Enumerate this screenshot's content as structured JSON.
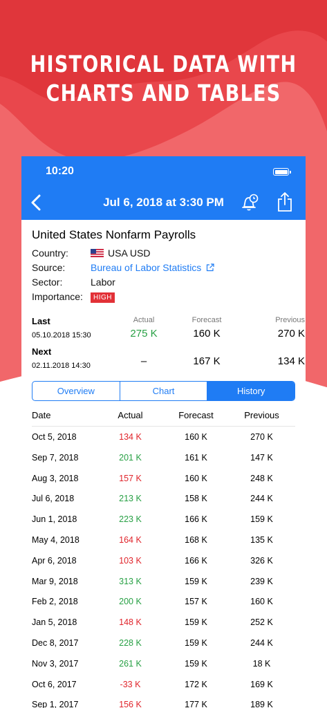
{
  "hero": {
    "line1": "HISTORICAL DATA WITH",
    "line2": "CHARTS AND TABLES"
  },
  "colors": {
    "brand_red": "#e23137",
    "nav_blue": "#1f7cf4",
    "positive": "#27a044",
    "negative": "#e0242b"
  },
  "status_bar": {
    "time": "10:20"
  },
  "nav": {
    "title": "Jul 6, 2018 at 3:30 PM",
    "back_icon": "chevron-left-icon",
    "alarm_icon": "alarm-clock-icon",
    "share_icon": "share-icon"
  },
  "event": {
    "title": "United States Nonfarm Payrolls",
    "country_label": "Country:",
    "country_value": "USA USD",
    "country_flag": "us-flag-icon",
    "source_label": "Source:",
    "source_value": "Bureau of Labor Statistics",
    "sector_label": "Sector:",
    "sector_value": "Labor",
    "importance_label": "Importance:",
    "importance_value": "HIGH"
  },
  "releases": {
    "headers": {
      "actual": "Actual",
      "forecast": "Forecast",
      "previous": "Previous"
    },
    "last": {
      "label": "Last",
      "date": "05.10.2018 15:30",
      "actual": "275 K",
      "forecast": "160 K",
      "previous": "270 K"
    },
    "next": {
      "label": "Next",
      "date": "02.11.2018 14:30",
      "actual": "–",
      "forecast": "167 K",
      "previous": "134 K"
    }
  },
  "tabs": {
    "overview": "Overview",
    "chart": "Chart",
    "history": "History",
    "active": "History"
  },
  "history": {
    "headers": {
      "date": "Date",
      "actual": "Actual",
      "forecast": "Forecast",
      "previous": "Previous"
    },
    "rows": [
      {
        "date": "Oct 5, 2018",
        "actual": "134 K",
        "trend": "down",
        "forecast": "160 K",
        "previous": "270 K"
      },
      {
        "date": "Sep 7, 2018",
        "actual": "201 K",
        "trend": "up",
        "forecast": "161 K",
        "previous": "147 K"
      },
      {
        "date": "Aug 3, 2018",
        "actual": "157 K",
        "trend": "down",
        "forecast": "160 K",
        "previous": "248 K"
      },
      {
        "date": "Jul 6, 2018",
        "actual": "213 K",
        "trend": "up",
        "forecast": "158 K",
        "previous": "244 K"
      },
      {
        "date": "Jun 1, 2018",
        "actual": "223 K",
        "trend": "up",
        "forecast": "166 K",
        "previous": "159 K"
      },
      {
        "date": "May 4, 2018",
        "actual": "164 K",
        "trend": "down",
        "forecast": "168 K",
        "previous": "135 K"
      },
      {
        "date": "Apr 6, 2018",
        "actual": "103 K",
        "trend": "down",
        "forecast": "166 K",
        "previous": "326 K"
      },
      {
        "date": "Mar 9, 2018",
        "actual": "313 K",
        "trend": "up",
        "forecast": "159 K",
        "previous": "239 K"
      },
      {
        "date": "Feb 2, 2018",
        "actual": "200 K",
        "trend": "up",
        "forecast": "157 K",
        "previous": "160 K"
      },
      {
        "date": "Jan 5, 2018",
        "actual": "148 K",
        "trend": "down",
        "forecast": "159 K",
        "previous": "252 K"
      },
      {
        "date": "Dec 8, 2017",
        "actual": "228 K",
        "trend": "up",
        "forecast": "159 K",
        "previous": "244 K"
      },
      {
        "date": "Nov 3, 2017",
        "actual": "261 K",
        "trend": "up",
        "forecast": "159 K",
        "previous": "18 K"
      },
      {
        "date": "Oct 6, 2017",
        "actual": "-33 K",
        "trend": "down",
        "forecast": "172 K",
        "previous": "169 K"
      },
      {
        "date": "Sep 1, 2017",
        "actual": "156 K",
        "trend": "down",
        "forecast": "177 K",
        "previous": "189 K"
      }
    ]
  }
}
